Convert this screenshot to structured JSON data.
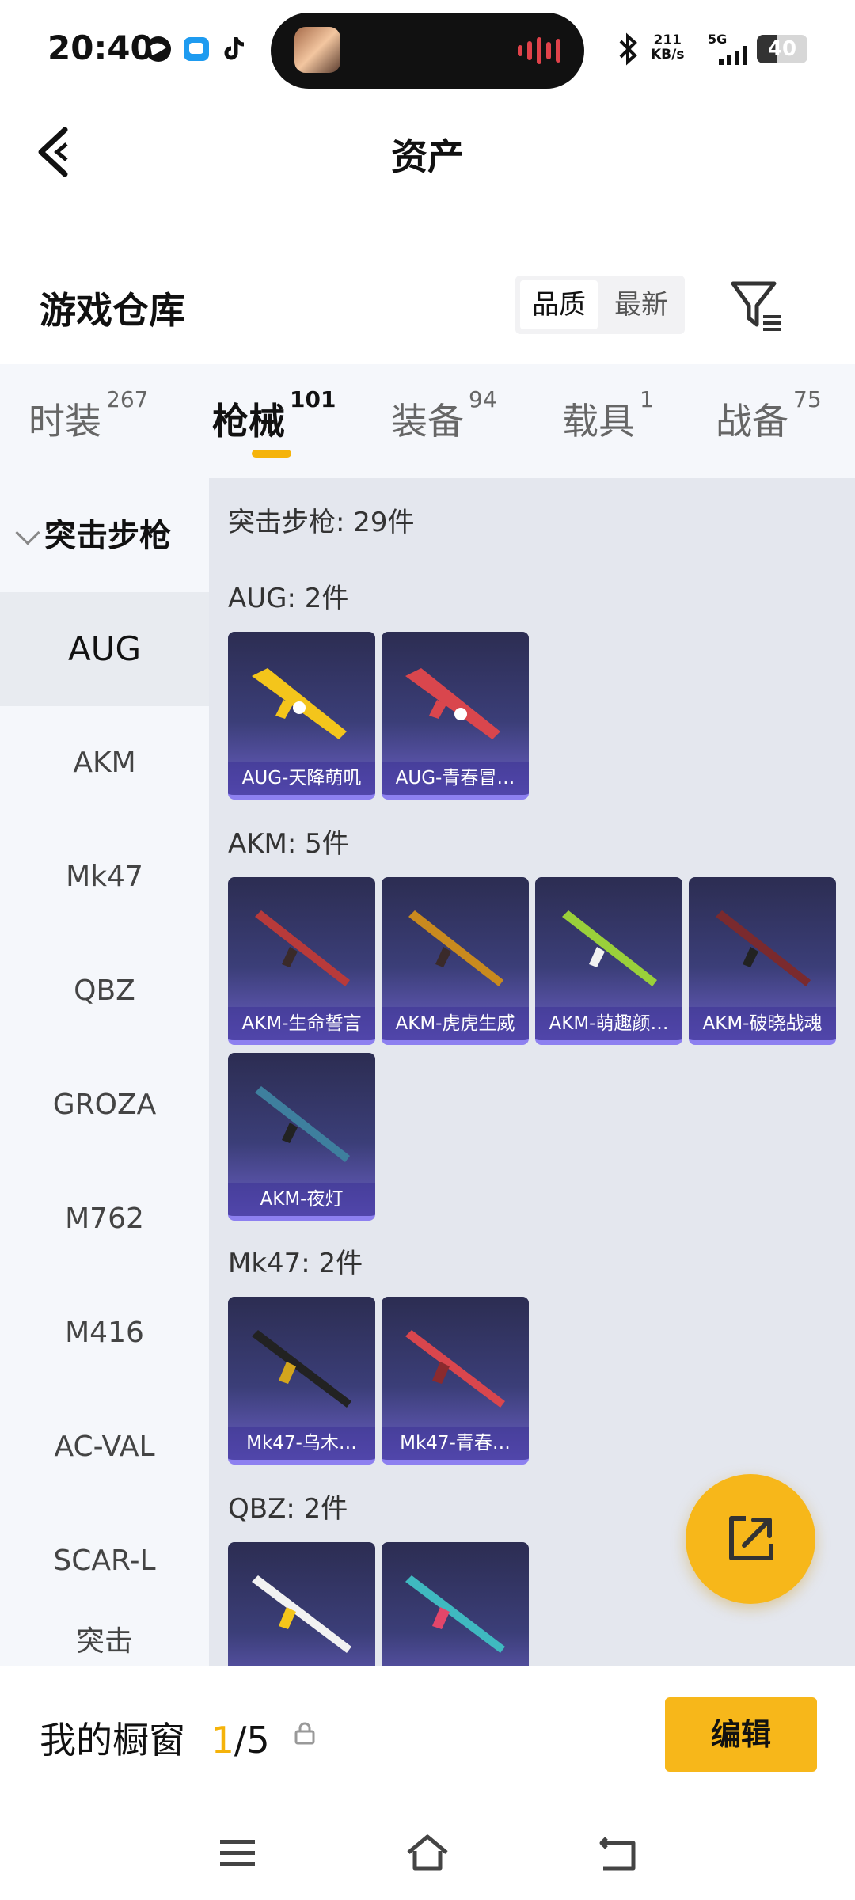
{
  "status_bar": {
    "time": "20:40",
    "net_speed": "211",
    "net_unit": "KB/s",
    "network": "5G",
    "battery": "40",
    "icons": [
      "browser-icon",
      "message-icon",
      "tiktok-icon",
      "bluetooth-icon",
      "signal-icon"
    ]
  },
  "header": {
    "title": "资产"
  },
  "warehouse": {
    "title": "游戏仓库",
    "sort_options": [
      "品质",
      "最新"
    ],
    "active_sort": "品质"
  },
  "tabs": [
    {
      "label": "时装",
      "count": "267"
    },
    {
      "label": "枪械",
      "count": "101"
    },
    {
      "label": "装备",
      "count": "94"
    },
    {
      "label": "载具",
      "count": "1"
    },
    {
      "label": "战备",
      "count": "75"
    }
  ],
  "active_tab": "枪械",
  "sidebar": {
    "category": "突击步枪",
    "items": [
      "AUG",
      "AKM",
      "Mk47",
      "QBZ",
      "GROZA",
      "M762",
      "M416",
      "AC-VAL",
      "SCAR-L",
      "突击"
    ],
    "active_item": "AUG"
  },
  "content": {
    "summary": "突击步枪: 29件",
    "groups": [
      {
        "label": "AUG: 2件",
        "items": [
          "AUG-天降萌叽",
          "AUG-青春冒…"
        ]
      },
      {
        "label": "AKM: 5件",
        "items": [
          "AKM-生命誓言",
          "AKM-虎虎生威",
          "AKM-萌趣颜…",
          "AKM-破晓战魂",
          "AKM-夜灯"
        ]
      },
      {
        "label": "Mk47: 2件",
        "items": [
          "Mk47-乌木…",
          "Mk47-青春…"
        ]
      },
      {
        "label": "QBZ: 2件",
        "items": [
          "",
          ""
        ]
      }
    ]
  },
  "showcase": {
    "label": "我的橱窗",
    "current": "1",
    "total": "/5",
    "edit_label": "编辑"
  },
  "colors": {
    "accent": "#f7b71a",
    "card_bg": "#3b3e78"
  }
}
